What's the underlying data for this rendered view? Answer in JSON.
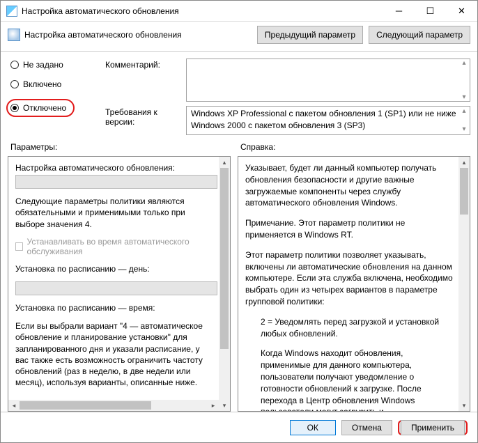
{
  "titlebar": {
    "title": "Настройка автоматического обновления"
  },
  "header": {
    "title": "Настройка автоматического обновления",
    "prev": "Предыдущий параметр",
    "next": "Следующий параметр"
  },
  "state": {
    "not_configured": "Не задано",
    "enabled": "Включено",
    "disabled": "Отключено",
    "selected": "disabled"
  },
  "labels": {
    "comment": "Комментарий:",
    "requirements": "Требования к версии:",
    "parameters": "Параметры:",
    "help": "Справка:"
  },
  "requirements_text": "Windows XP Professional с пакетом обновления 1 (SP1) или не ниже Windows 2000 с пакетом обновления 3 (SP3)",
  "params": {
    "section_title": "Настройка автоматического обновления:",
    "note1": "Следующие параметры политики являются обязательными и применимыми только при выборе значения 4.",
    "chk_label": "Устанавливать во время автоматического обслуживания",
    "day_label": "Установка по расписанию — день:",
    "time_label": "Установка по расписанию — время:",
    "note2": "Если вы выбрали вариант \"4 — автоматическое обновление и планирование установки\" для запланированного дня и указали расписание, у вас также есть возможность ограничить частоту обновлений (раз в неделю, в две недели или месяц), используя варианты, описанные ниже."
  },
  "help": {
    "p1": "Указывает, будет ли данный компьютер получать обновления безопасности и другие важные загружаемые компоненты через службу автоматического обновления Windows.",
    "p2": "Примечание. Этот параметр политики не применяется в Windows RT.",
    "p3": "Этот параметр политики позволяет указывать, включены ли автоматические обновления на данном компьютере. Если эта служба включена, необходимо выбрать один из четырех вариантов в параметре групповой политики:",
    "p4": "2 = Уведомлять перед загрузкой и установкой любых обновлений.",
    "p5": "Когда Windows находит обновления, применимые для данного компьютера, пользователи получают уведомление о готовности обновлений к загрузке. После перехода в Центр обновления Windows пользователи могут загрузить и"
  },
  "buttons": {
    "ok": "ОК",
    "cancel": "Отмена",
    "apply": "Применить"
  }
}
